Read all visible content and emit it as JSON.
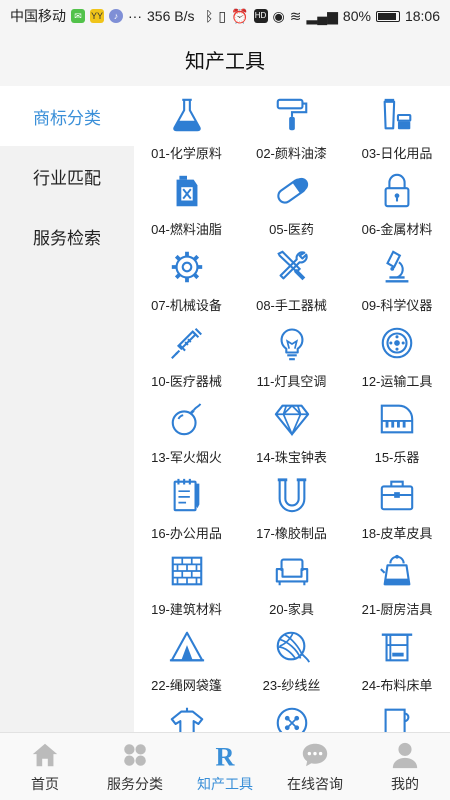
{
  "status": {
    "carrier": "中国移动",
    "speed": "356 B/s",
    "battery": "80%",
    "time": "18:06"
  },
  "title": "知产工具",
  "sidebar": {
    "items": [
      {
        "label": "商标分类",
        "active": true
      },
      {
        "label": "行业匹配",
        "active": false
      },
      {
        "label": "服务检索",
        "active": false
      }
    ]
  },
  "categories": [
    {
      "label": "01-化学原料",
      "icon": "flask-icon"
    },
    {
      "label": "02-颜料油漆",
      "icon": "paint-roller-icon"
    },
    {
      "label": "03-日化用品",
      "icon": "cosmetics-icon"
    },
    {
      "label": "04-燃料油脂",
      "icon": "fuel-can-icon"
    },
    {
      "label": "05-医药",
      "icon": "capsule-icon"
    },
    {
      "label": "06-金属材料",
      "icon": "padlock-icon"
    },
    {
      "label": "07-机械设备",
      "icon": "gear-icon"
    },
    {
      "label": "08-手工器械",
      "icon": "tools-icon"
    },
    {
      "label": "09-科学仪器",
      "icon": "microscope-icon"
    },
    {
      "label": "10-医疗器械",
      "icon": "syringe-icon"
    },
    {
      "label": "11-灯具空调",
      "icon": "lightbulb-icon"
    },
    {
      "label": "12-运输工具",
      "icon": "wheel-icon"
    },
    {
      "label": "13-军火烟火",
      "icon": "bomb-icon"
    },
    {
      "label": "14-珠宝钟表",
      "icon": "diamond-icon"
    },
    {
      "label": "15-乐器",
      "icon": "piano-icon"
    },
    {
      "label": "16-办公用品",
      "icon": "notepad-icon"
    },
    {
      "label": "17-橡胶制品",
      "icon": "pipe-icon"
    },
    {
      "label": "18-皮革皮具",
      "icon": "briefcase-icon"
    },
    {
      "label": "19-建筑材料",
      "icon": "brick-wall-icon"
    },
    {
      "label": "20-家具",
      "icon": "sofa-icon"
    },
    {
      "label": "21-厨房洁具",
      "icon": "kettle-icon"
    },
    {
      "label": "22-绳网袋篷",
      "icon": "tent-icon"
    },
    {
      "label": "23-纱线丝",
      "icon": "yarn-icon"
    },
    {
      "label": "24-布料床单",
      "icon": "towel-icon"
    },
    {
      "label": "",
      "icon": "clothing-icon"
    },
    {
      "label": "",
      "icon": "button-icon"
    },
    {
      "label": "",
      "icon": "carpet-icon"
    }
  ],
  "tabbar": {
    "items": [
      {
        "label": "首页",
        "icon": "home-icon",
        "active": false
      },
      {
        "label": "服务分类",
        "icon": "grid-icon",
        "active": false
      },
      {
        "label": "知产工具",
        "icon": "r-logo-icon",
        "active": true
      },
      {
        "label": "在线咨询",
        "icon": "chat-icon",
        "active": false
      },
      {
        "label": "我的",
        "icon": "user-icon",
        "active": false
      }
    ]
  },
  "colors": {
    "accent": "#3a8fd8",
    "icon": "#2f7ed3",
    "sidebar_bg": "#f2f2f2",
    "tab_inactive": "#bbbbbb"
  }
}
